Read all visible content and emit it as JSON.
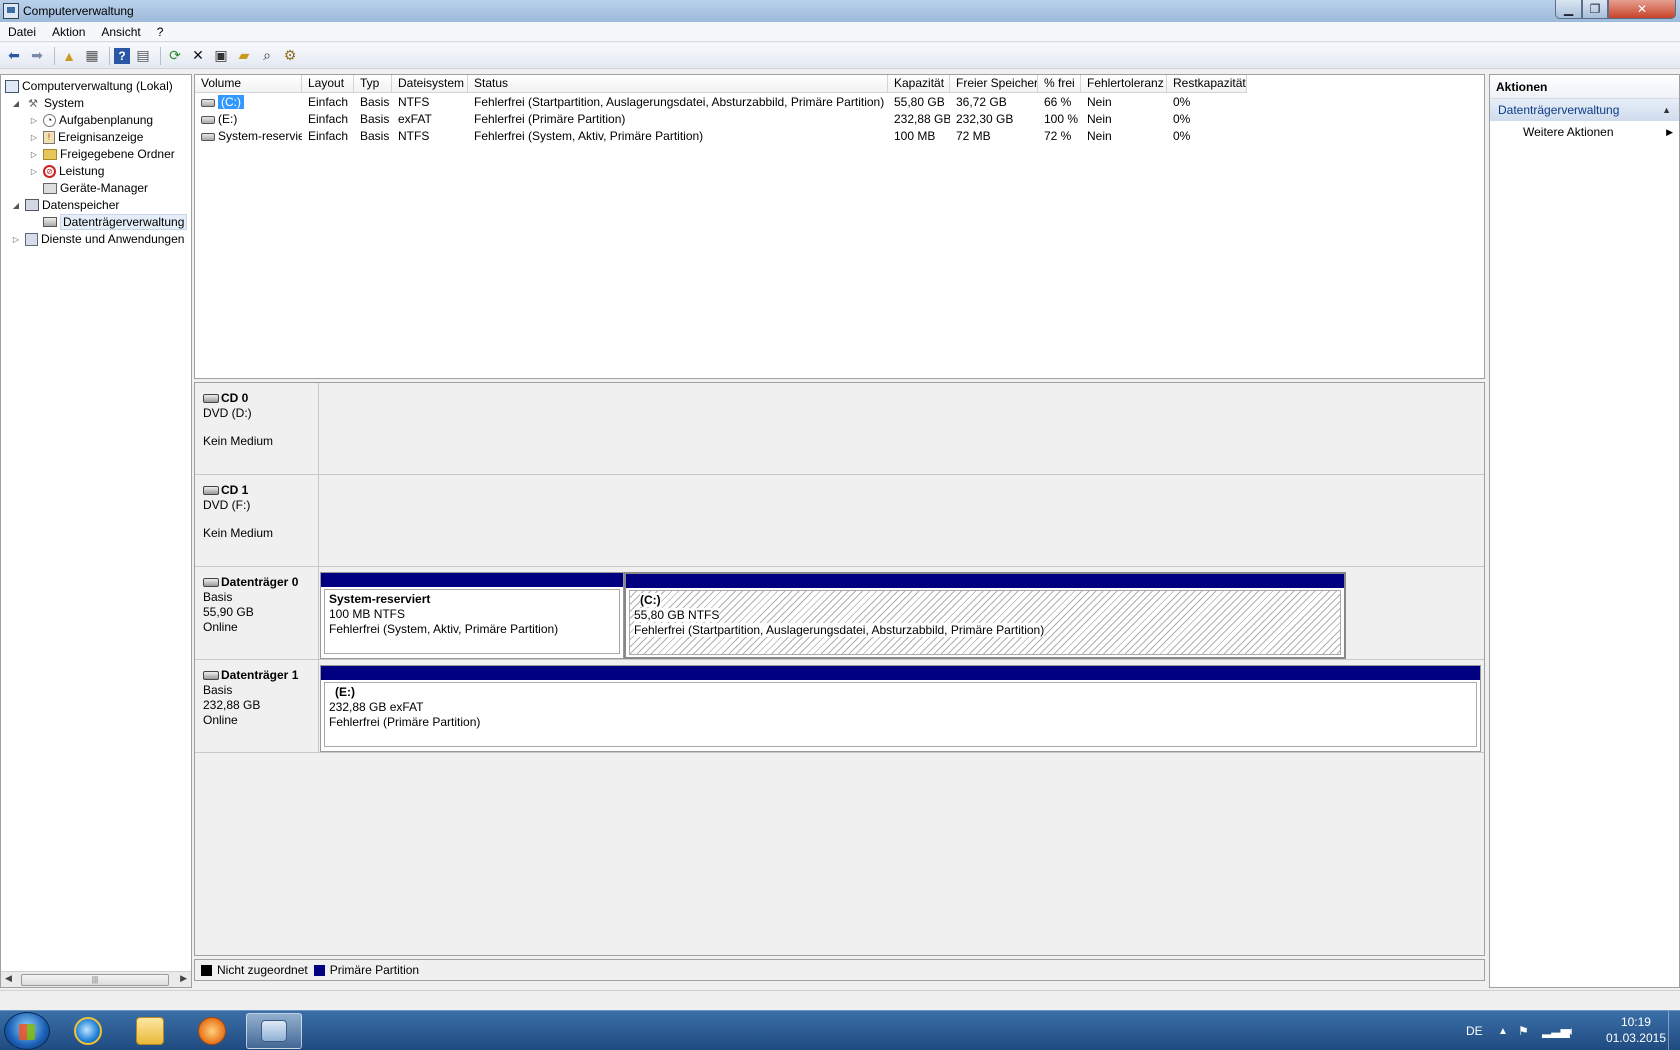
{
  "window": {
    "title": "Computerverwaltung"
  },
  "menu": {
    "items": [
      "Datei",
      "Aktion",
      "Ansicht",
      "?"
    ]
  },
  "toolbar": {
    "icons": [
      "back-arrow-icon",
      "forward-arrow-icon",
      "up-folder-icon",
      "show-hide-tree-icon",
      "help-icon",
      "show-hide-actions-icon",
      "refresh-icon",
      "delete-icon",
      "properties-icon",
      "open-icon",
      "search-icon",
      "settings-icon"
    ]
  },
  "tree": {
    "items": [
      {
        "label": "Computerverwaltung (Lokal)"
      },
      {
        "label": "System"
      },
      {
        "label": "Aufgabenplanung"
      },
      {
        "label": "Ereignisanzeige"
      },
      {
        "label": "Freigegebene Ordner"
      },
      {
        "label": "Leistung"
      },
      {
        "label": "Geräte-Manager"
      },
      {
        "label": "Datenspeicher"
      },
      {
        "label": "Datenträgerverwaltung"
      },
      {
        "label": "Dienste und Anwendungen"
      }
    ]
  },
  "volumes": {
    "columns": [
      "Volume",
      "Layout",
      "Typ",
      "Dateisystem",
      "Status",
      "Kapazität",
      "Freier Speicher",
      "% frei",
      "Fehlertoleranz",
      "Restkapazität"
    ],
    "rows": [
      [
        "(C:)",
        "Einfach",
        "Basis",
        "NTFS",
        "Fehlerfrei (Startpartition, Auslagerungsdatei, Absturzabbild, Primäre Partition)",
        "55,80 GB",
        "36,72 GB",
        "66 %",
        "Nein",
        "0%"
      ],
      [
        "(E:)",
        "Einfach",
        "Basis",
        "exFAT",
        "Fehlerfrei (Primäre Partition)",
        "232,88 GB",
        "232,30 GB",
        "100 %",
        "Nein",
        "0%"
      ],
      [
        "System-reserviert",
        "Einfach",
        "Basis",
        "NTFS",
        "Fehlerfrei (System, Aktiv, Primäre Partition)",
        "100 MB",
        "72 MB",
        "72 %",
        "Nein",
        "0%"
      ]
    ]
  },
  "disks": {
    "cd0": {
      "name": "CD 0",
      "line1": "DVD (D:)",
      "line2": "Kein Medium"
    },
    "cd1": {
      "name": "CD 1",
      "line1": "DVD (F:)",
      "line2": "Kein Medium"
    },
    "disk0": {
      "name": "Datenträger 0",
      "type": "Basis",
      "size": "55,90 GB",
      "state": "Online",
      "partitions": [
        {
          "name": "System-reserviert",
          "size": "100 MB NTFS",
          "status": "Fehlerfrei (System, Aktiv, Primäre Partition)"
        },
        {
          "name": "(C:)",
          "size": "55,80 GB NTFS",
          "status": "Fehlerfrei (Startpartition, Auslagerungsdatei, Absturzabbild, Primäre Partition)"
        }
      ]
    },
    "disk1": {
      "name": "Datenträger 1",
      "type": "Basis",
      "size": "232,88 GB",
      "state": "Online",
      "partitions": [
        {
          "name": "(E:)",
          "size": "232,88 GB exFAT",
          "status": "Fehlerfrei (Primäre Partition)"
        }
      ]
    }
  },
  "legend": {
    "items": [
      {
        "label": "Nicht zugeordnet",
        "color": "#000000"
      },
      {
        "label": "Primäre Partition",
        "color": "#000080"
      }
    ]
  },
  "actions": {
    "header": "Aktionen",
    "section": "Datenträgerverwaltung",
    "items": [
      "Weitere Aktionen"
    ]
  },
  "taskbar": {
    "language": "DE",
    "time": "10:19",
    "date": "01.03.2015"
  },
  "colors": {
    "primary_partition": "#000080",
    "selection": "#3399ff",
    "titlebar": "#9ebbdb"
  }
}
